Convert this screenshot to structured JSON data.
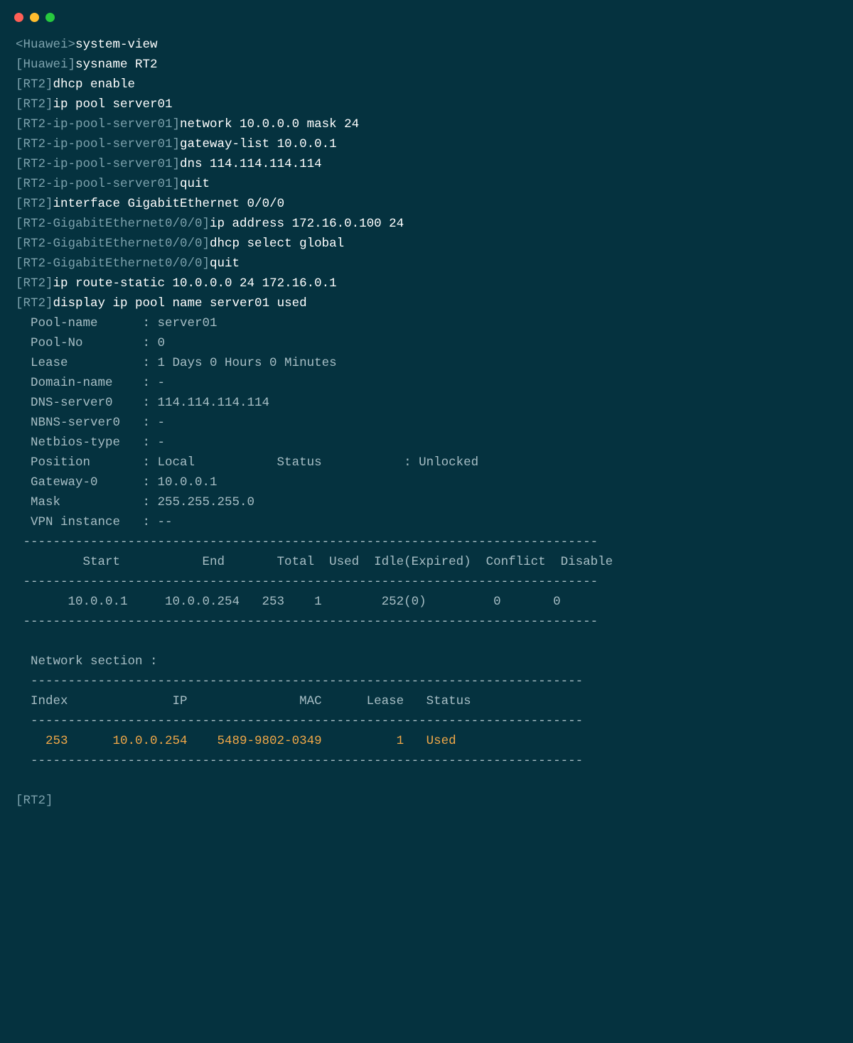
{
  "lines": [
    {
      "segments": [
        {
          "cls": "prompt-dim",
          "text": "<Huawei>"
        },
        {
          "cls": "cmd",
          "text": "system-view"
        }
      ]
    },
    {
      "segments": [
        {
          "cls": "prompt-dim",
          "text": "[Huawei]"
        },
        {
          "cls": "cmd",
          "text": "sysname RT2"
        }
      ]
    },
    {
      "segments": [
        {
          "cls": "prompt-dim",
          "text": "[RT2]"
        },
        {
          "cls": "cmd",
          "text": "dhcp enable"
        }
      ]
    },
    {
      "segments": [
        {
          "cls": "prompt-dim",
          "text": "[RT2]"
        },
        {
          "cls": "cmd",
          "text": "ip pool server01"
        }
      ]
    },
    {
      "segments": [
        {
          "cls": "prompt-dim",
          "text": "[RT2-ip-pool-server01]"
        },
        {
          "cls": "cmd",
          "text": "network 10.0.0.0 mask 24"
        }
      ]
    },
    {
      "segments": [
        {
          "cls": "prompt-dim",
          "text": "[RT2-ip-pool-server01]"
        },
        {
          "cls": "cmd",
          "text": "gateway-list 10.0.0.1"
        }
      ]
    },
    {
      "segments": [
        {
          "cls": "prompt-dim",
          "text": "[RT2-ip-pool-server01]"
        },
        {
          "cls": "cmd",
          "text": "dns 114.114.114.114"
        }
      ]
    },
    {
      "segments": [
        {
          "cls": "prompt-dim",
          "text": "[RT2-ip-pool-server01]"
        },
        {
          "cls": "cmd",
          "text": "quit"
        }
      ]
    },
    {
      "segments": [
        {
          "cls": "prompt-dim",
          "text": "[RT2]"
        },
        {
          "cls": "cmd",
          "text": "interface GigabitEthernet 0/0/0"
        }
      ]
    },
    {
      "segments": [
        {
          "cls": "prompt-dim",
          "text": "[RT2-GigabitEthernet0/0/0]"
        },
        {
          "cls": "cmd",
          "text": "ip address 172.16.0.100 24"
        }
      ]
    },
    {
      "segments": [
        {
          "cls": "prompt-dim",
          "text": "[RT2-GigabitEthernet0/0/0]"
        },
        {
          "cls": "cmd",
          "text": "dhcp select global"
        }
      ]
    },
    {
      "segments": [
        {
          "cls": "prompt-dim",
          "text": "[RT2-GigabitEthernet0/0/0]"
        },
        {
          "cls": "cmd",
          "text": "quit"
        }
      ]
    },
    {
      "segments": [
        {
          "cls": "prompt-dim",
          "text": "[RT2]"
        },
        {
          "cls": "cmd",
          "text": "ip route-static 10.0.0.0 24 172.16.0.1"
        }
      ]
    },
    {
      "segments": [
        {
          "cls": "prompt-dim",
          "text": "[RT2]"
        },
        {
          "cls": "cmd",
          "text": "display ip pool name server01 used"
        }
      ]
    },
    {
      "segments": [
        {
          "cls": "output",
          "text": "  Pool-name      : server01"
        }
      ]
    },
    {
      "segments": [
        {
          "cls": "output",
          "text": "  Pool-No        : 0"
        }
      ]
    },
    {
      "segments": [
        {
          "cls": "output",
          "text": "  Lease          : 1 Days 0 Hours 0 Minutes"
        }
      ]
    },
    {
      "segments": [
        {
          "cls": "output",
          "text": "  Domain-name    : -"
        }
      ]
    },
    {
      "segments": [
        {
          "cls": "output",
          "text": "  DNS-server0    : 114.114.114.114"
        }
      ]
    },
    {
      "segments": [
        {
          "cls": "output",
          "text": "  NBNS-server0   : -"
        }
      ]
    },
    {
      "segments": [
        {
          "cls": "output",
          "text": "  Netbios-type   : -"
        }
      ]
    },
    {
      "segments": [
        {
          "cls": "output",
          "text": "  Position       : Local           Status           : Unlocked"
        }
      ]
    },
    {
      "segments": [
        {
          "cls": "output",
          "text": "  Gateway-0      : 10.0.0.1"
        }
      ]
    },
    {
      "segments": [
        {
          "cls": "output",
          "text": "  Mask           : 255.255.255.0"
        }
      ]
    },
    {
      "segments": [
        {
          "cls": "output",
          "text": "  VPN instance   : --"
        }
      ]
    },
    {
      "segments": [
        {
          "cls": "output",
          "text": " -----------------------------------------------------------------------------"
        }
      ]
    },
    {
      "segments": [
        {
          "cls": "output",
          "text": "         Start           End       Total  Used  Idle(Expired)  Conflict  Disable"
        }
      ]
    },
    {
      "segments": [
        {
          "cls": "output",
          "text": " -----------------------------------------------------------------------------"
        }
      ]
    },
    {
      "segments": [
        {
          "cls": "output",
          "text": "       10.0.0.1     10.0.0.254   253    1        252(0)         0       0"
        }
      ]
    },
    {
      "segments": [
        {
          "cls": "output",
          "text": " -----------------------------------------------------------------------------"
        }
      ]
    },
    {
      "segments": [
        {
          "cls": "output",
          "text": ""
        }
      ]
    },
    {
      "segments": [
        {
          "cls": "output",
          "text": "  Network section : "
        }
      ]
    },
    {
      "segments": [
        {
          "cls": "output",
          "text": "  --------------------------------------------------------------------------"
        }
      ]
    },
    {
      "segments": [
        {
          "cls": "output",
          "text": "  Index              IP               MAC      Lease   Status  "
        }
      ]
    },
    {
      "segments": [
        {
          "cls": "output",
          "text": "  --------------------------------------------------------------------------"
        }
      ]
    },
    {
      "segments": [
        {
          "cls": "highlight",
          "text": "    253      10.0.0.254    5489-9802-0349          1   Used       "
        }
      ]
    },
    {
      "segments": [
        {
          "cls": "output",
          "text": "  --------------------------------------------------------------------------"
        }
      ]
    },
    {
      "segments": [
        {
          "cls": "output",
          "text": ""
        }
      ]
    },
    {
      "segments": [
        {
          "cls": "prompt-dim",
          "text": "[RT2]"
        }
      ]
    }
  ]
}
